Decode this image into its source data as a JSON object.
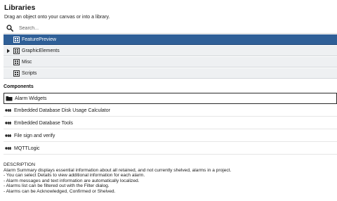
{
  "panel": {
    "title": "Libraries",
    "subtitle": "Drag an object onto your canvas or into a library."
  },
  "search": {
    "placeholder": "Search...",
    "value": ""
  },
  "libraries": [
    {
      "label": "FeaturePreview",
      "selected": true,
      "expandable": false,
      "icon": "library-icon"
    },
    {
      "label": "GraphicElements",
      "selected": false,
      "expandable": true,
      "icon": "library-icon"
    },
    {
      "label": "Misc",
      "selected": false,
      "expandable": false,
      "icon": "library-icon"
    },
    {
      "label": "Scripts",
      "selected": false,
      "expandable": false,
      "icon": "library-icon"
    }
  ],
  "components": {
    "title": "Components",
    "items": [
      {
        "label": "Alarm Widgets",
        "icon": "folder-icon",
        "selected": true
      },
      {
        "label": "Embedded Database Disk Usage Calculator",
        "icon": "component-icon",
        "selected": false
      },
      {
        "label": "Embedded Database Tools",
        "icon": "component-icon",
        "selected": false
      },
      {
        "label": "File sign and verify",
        "icon": "component-icon",
        "selected": false
      },
      {
        "label": "MQTTLogic",
        "icon": "component-icon",
        "selected": false
      }
    ]
  },
  "description": {
    "heading": "DESCRIPTION",
    "lines": [
      "Alarm Summary displays essential information about all retained, and not currently shelved, alarms in a project.",
      "- You can select Details to view additional information for each alarm.",
      "- Alarm messages and text information are automatically localized.",
      "- Alarms list can be filtered out with the Filter dialog.",
      "- Alarms can be Acknowledged, Confirmed or Shelved."
    ]
  },
  "colors": {
    "selected_row": "#2f5f97",
    "row_bg": "#eef0f2"
  }
}
